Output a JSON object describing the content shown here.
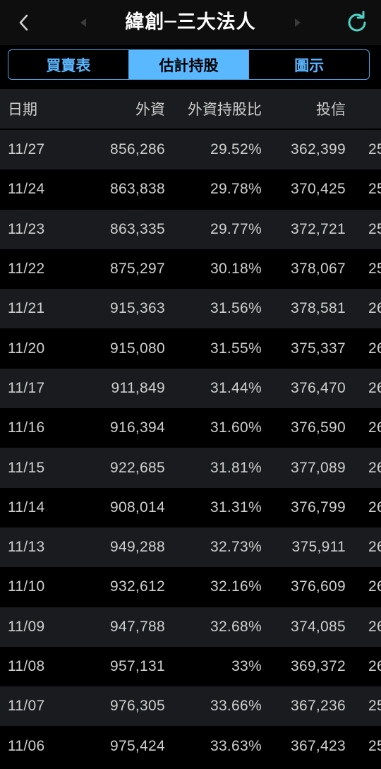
{
  "header": {
    "title": "緯創─三大法人"
  },
  "tabs": [
    {
      "label": "買賣表",
      "active": false
    },
    {
      "label": "估計持股",
      "active": true
    },
    {
      "label": "圖示",
      "active": false
    }
  ],
  "table": {
    "columns": [
      "日期",
      "外資",
      "外資持股比",
      "投信"
    ],
    "rows": [
      {
        "date": "11/27",
        "foreign": "856,286",
        "ratio": "29.52%",
        "trust": "362,399",
        "next": "25"
      },
      {
        "date": "11/24",
        "foreign": "863,838",
        "ratio": "29.78%",
        "trust": "370,425",
        "next": "25"
      },
      {
        "date": "11/23",
        "foreign": "863,335",
        "ratio": "29.77%",
        "trust": "372,721",
        "next": "25"
      },
      {
        "date": "11/22",
        "foreign": "875,297",
        "ratio": "30.18%",
        "trust": "378,067",
        "next": "25"
      },
      {
        "date": "11/21",
        "foreign": "915,363",
        "ratio": "31.56%",
        "trust": "378,581",
        "next": "26"
      },
      {
        "date": "11/20",
        "foreign": "915,080",
        "ratio": "31.55%",
        "trust": "375,337",
        "next": "26"
      },
      {
        "date": "11/17",
        "foreign": "911,849",
        "ratio": "31.44%",
        "trust": "376,470",
        "next": "26"
      },
      {
        "date": "11/16",
        "foreign": "916,394",
        "ratio": "31.60%",
        "trust": "376,590",
        "next": "26"
      },
      {
        "date": "11/15",
        "foreign": "922,685",
        "ratio": "31.81%",
        "trust": "377,089",
        "next": "26"
      },
      {
        "date": "11/14",
        "foreign": "908,014",
        "ratio": "31.31%",
        "trust": "376,799",
        "next": "26"
      },
      {
        "date": "11/13",
        "foreign": "949,288",
        "ratio": "32.73%",
        "trust": "375,911",
        "next": "26"
      },
      {
        "date": "11/10",
        "foreign": "932,612",
        "ratio": "32.16%",
        "trust": "376,609",
        "next": "26"
      },
      {
        "date": "11/09",
        "foreign": "947,788",
        "ratio": "32.68%",
        "trust": "374,085",
        "next": "26"
      },
      {
        "date": "11/08",
        "foreign": "957,131",
        "ratio": "33%",
        "trust": "369,372",
        "next": "26"
      },
      {
        "date": "11/07",
        "foreign": "976,305",
        "ratio": "33.66%",
        "trust": "367,236",
        "next": "25"
      },
      {
        "date": "11/06",
        "foreign": "975,424",
        "ratio": "33.63%",
        "trust": "367,423",
        "next": "25"
      }
    ]
  },
  "icons": {
    "back": "chevron-left-icon",
    "prev": "triangle-left-icon",
    "next": "triangle-right-icon",
    "refresh": "refresh-icon"
  },
  "colors": {
    "accent": "#59b8ff",
    "refresh": "#4fd1c5",
    "background": "#000000",
    "row_alt": "#1a1b1e"
  }
}
